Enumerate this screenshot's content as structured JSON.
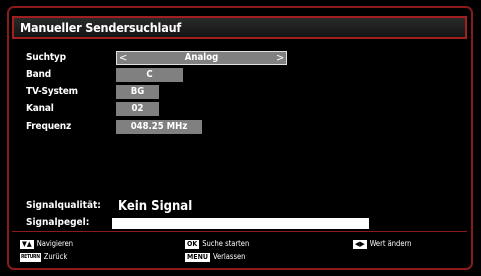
{
  "title": "Manueller Sendersuchlauf",
  "rows": {
    "suchtyp": {
      "label": "Suchtyp",
      "value": "Analog"
    },
    "band": {
      "label": "Band",
      "value": "C"
    },
    "tv_system": {
      "label": "TV-System",
      "value": "BG"
    },
    "kanal": {
      "label": "Kanal",
      "value": "02"
    },
    "frequenz": {
      "label": "Frequenz",
      "value": "048.25 MHz"
    }
  },
  "signal": {
    "quality_label": "Signalqualität:",
    "quality_value": "Kein Signal",
    "level_label": "Signalpegel:"
  },
  "hints": {
    "navigate_keys": "▼▲",
    "navigate": "Navigieren",
    "back_key": "RETURN",
    "back": "Zurück",
    "ok_key": "OK",
    "ok": "Suche starten",
    "menu_key": "MENU",
    "menu": "Verlassen",
    "change_keys": "◀▶",
    "change": "Wert ändern"
  },
  "colors": {
    "frame": "#8b1a1a",
    "field": "#808080"
  }
}
